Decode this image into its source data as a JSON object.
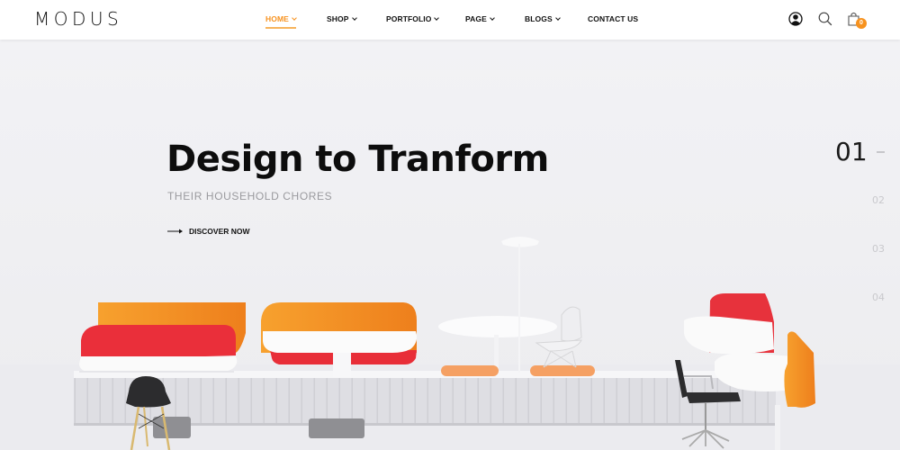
{
  "brand": {
    "logo": "MODUS"
  },
  "nav": {
    "items": [
      {
        "label": "HOME",
        "has_dropdown": true,
        "active": true
      },
      {
        "label": "SHOP",
        "has_dropdown": true,
        "active": false
      },
      {
        "label": "PORTFOLIO",
        "has_dropdown": true,
        "active": false
      },
      {
        "label": "PAGE",
        "has_dropdown": true,
        "active": false
      },
      {
        "label": "BLOGS",
        "has_dropdown": true,
        "active": false
      },
      {
        "label": "CONTACT US",
        "has_dropdown": false,
        "active": false
      }
    ]
  },
  "header_icons": {
    "account": "user-icon",
    "search": "search-icon",
    "cart": "shopping-bag-icon",
    "cart_count": "0"
  },
  "hero": {
    "title": "Design to Tranform",
    "subtitle": "THEIR HOUSEHOLD CHORES",
    "cta_label": "DISCOVER NOW",
    "cta_icon": "arrow-right-icon",
    "image_description": "Minimal furniture scene with orange and red curved bench seats, white tables, floor lamp, wire chair, black chairs on a white platform"
  },
  "slider": {
    "current": "01",
    "slides": [
      "01",
      "02",
      "03",
      "04"
    ]
  },
  "colors": {
    "accent": "#f7921e",
    "text_dark": "#111111",
    "subtitle_gray": "#9a9a9e",
    "hero_bg": "#f1f1f4"
  }
}
